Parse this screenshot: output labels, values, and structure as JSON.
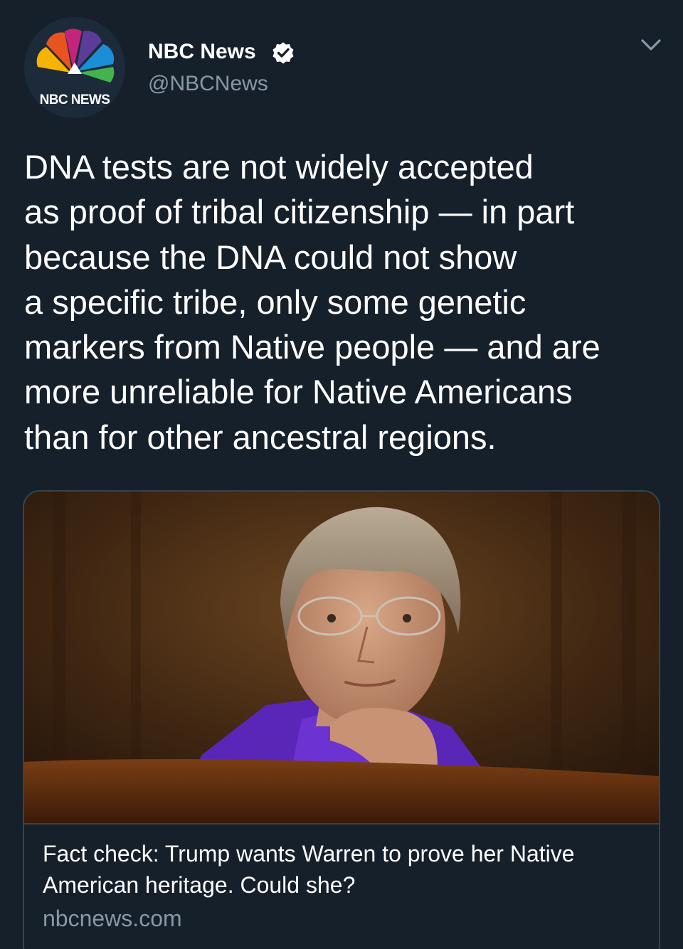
{
  "account": {
    "display_name": "NBC News",
    "handle": "@NBCNews",
    "avatar_label": "NBC NEWS",
    "verified": true
  },
  "tweet": {
    "lines": [
      "DNA tests are not widely accepted",
      "as proof of tribal citizenship — in part",
      "because the DNA could not show",
      "a specific tribe, only some genetic",
      "markers from Native people — and are",
      "more unreliable for Native Americans",
      "than for other ancestral regions."
    ]
  },
  "card": {
    "title_lines": [
      "Fact check: Trump wants Warren to prove her Native",
      "American heritage. Could she?"
    ],
    "domain": "nbcnews.com"
  },
  "colors": {
    "background": "#15202b",
    "secondary_text": "#8899a6",
    "border": "#38444d",
    "verified_badge": "#ffffff"
  },
  "icons": {
    "verified": "verified-badge-icon",
    "more": "chevron-down-icon",
    "logo": "nbc-peacock-icon"
  }
}
